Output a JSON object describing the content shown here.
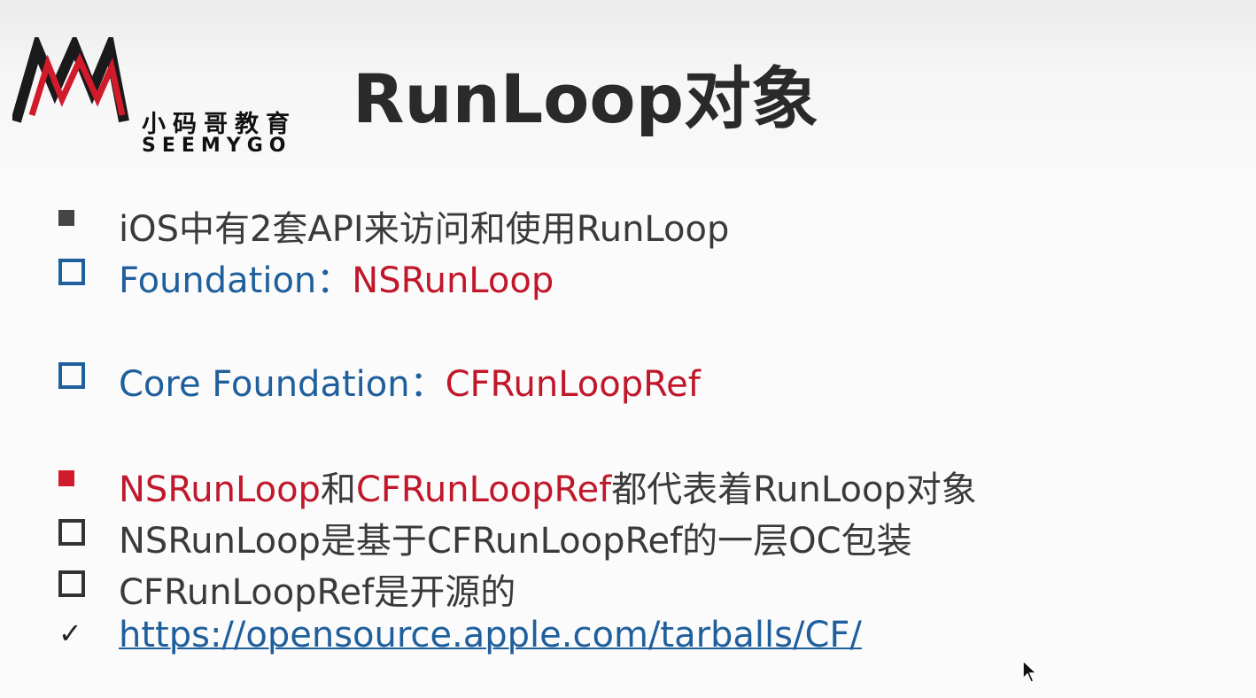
{
  "logo": {
    "chinese": "小码哥教育",
    "english": "SEEMYGO"
  },
  "title": "RunLoop对象",
  "items": [
    {
      "text": "iOS中有2套API来访问和使用RunLoop"
    },
    {
      "label": "Foundation",
      "sep": "：",
      "value": "NSRunLoop"
    },
    {
      "label": "Core Foundation",
      "sep": "：",
      "value": "CFRunLoopRef"
    },
    {
      "part1": "NSRunLoop",
      "part2": "和",
      "part3": "CFRunLoopRef",
      "part4": "都代表着RunLoop对象"
    },
    {
      "text": "NSRunLoop是基于CFRunLoopRef的一层OC包装"
    },
    {
      "text": "CFRunLoopRef是开源的"
    },
    {
      "check": "✓",
      "link": "https://opensource.apple.com/tarballs/CF/"
    }
  ]
}
